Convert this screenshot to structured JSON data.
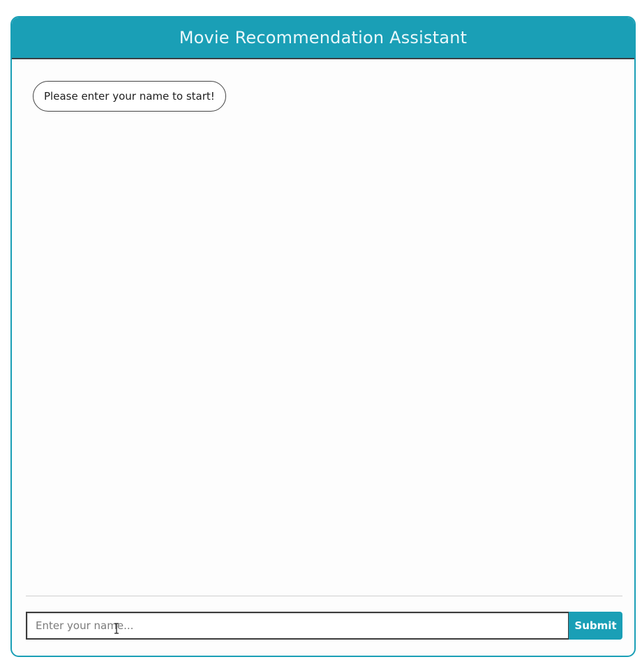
{
  "header": {
    "title": "Movie Recommendation Assistant"
  },
  "chat": {
    "messages": [
      {
        "sender": "bot",
        "text": "Please enter your name to start!"
      }
    ]
  },
  "input": {
    "placeholder": "Enter your name...",
    "value": "",
    "submit_label": "Submit"
  },
  "colors": {
    "accent": "#1a9fb6",
    "header_text": "#e9f7fa",
    "bubble_border": "#444444"
  },
  "icons": {
    "cursor": "text-cursor-icon"
  }
}
